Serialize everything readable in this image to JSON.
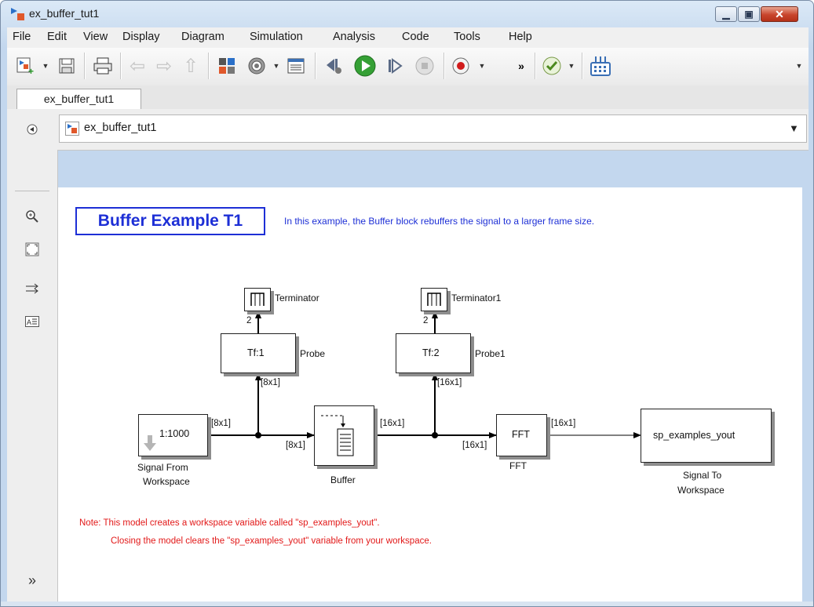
{
  "window": {
    "title": "ex_buffer_tut1"
  },
  "menu": [
    "File",
    "Edit",
    "View",
    "Display",
    "Diagram",
    "Simulation",
    "Analysis",
    "Code",
    "Tools",
    "Help"
  ],
  "toolbar": {
    "overflow_glyph": "»"
  },
  "tabs": [
    {
      "label": "ex_buffer_tut1",
      "active": true
    }
  ],
  "explorer": {
    "path": "ex_buffer_tut1"
  },
  "left_tools": [
    "zoom-icon",
    "fit-view-icon",
    "route-lines-icon",
    "annotation-icon"
  ],
  "left_bottom_glyph": "»",
  "diagram": {
    "title": "Buffer Example T1",
    "description": "In this example, the Buffer block rebuffers the signal to a larger frame size.",
    "blocks": {
      "source": {
        "value": "1:1000",
        "label_line1": "Signal From",
        "label_line2": "Workspace"
      },
      "buffer": {
        "label": "Buffer"
      },
      "fft": {
        "value": "FFT",
        "label": "FFT"
      },
      "sink": {
        "value": "sp_examples_yout",
        "label_line1": "Signal To",
        "label_line2": "Workspace"
      },
      "probe": {
        "value": "Tf:1",
        "label": "Probe"
      },
      "probe1": {
        "value": "Tf:2",
        "label": "Probe1"
      },
      "terminator": {
        "label": "Terminator"
      },
      "terminator1": {
        "label": "Terminator1"
      }
    },
    "signals": {
      "source_out": "[8x1]",
      "buffer_in": "[8x1]",
      "probe_in": "[8x1]",
      "probe_out": "2",
      "buffer_out": "[16x1]",
      "fft_in": "[16x1]",
      "probe1_in": "[16x1]",
      "probe1_out": "2",
      "fft_out": "[16x1]"
    },
    "notes": {
      "line1": "Note: This model creates a workspace variable called \"sp_examples_yout\".",
      "line2": "Closing the model clears the \"sp_examples_yout\" variable from your workspace."
    }
  },
  "colors": {
    "accent_blue": "#1d2fd6",
    "note_red": "#e21818"
  }
}
